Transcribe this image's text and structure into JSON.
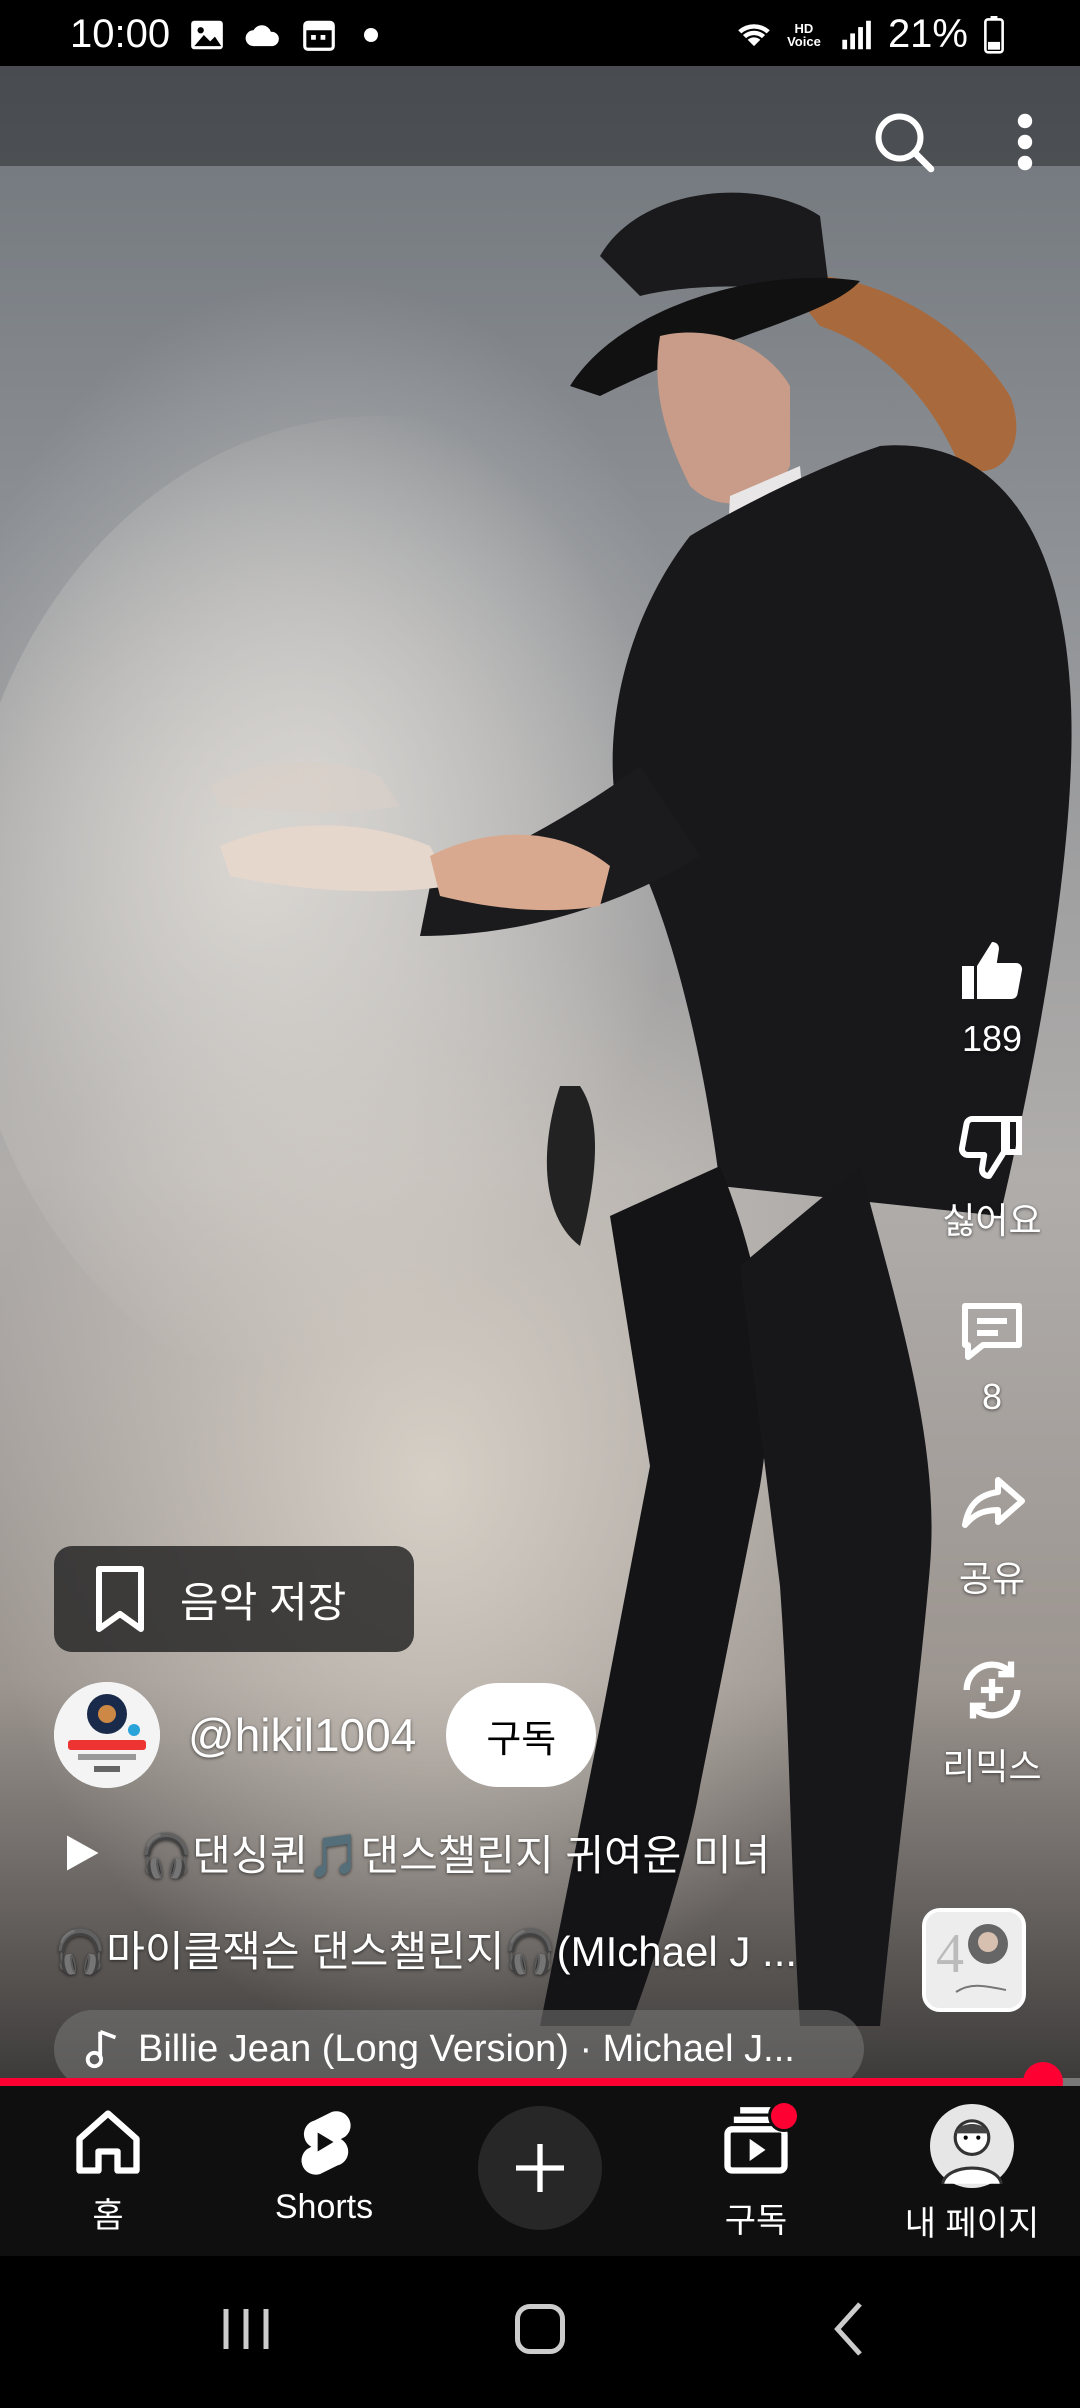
{
  "status_bar": {
    "time": "10:00",
    "battery": "21%",
    "hd_voice": "HD\nVoice"
  },
  "video": {
    "likes": "189",
    "dislike_label": "싫어요",
    "comments": "8",
    "share_label": "공유",
    "remix_label": "리믹스",
    "save_music_label": "음악 저장",
    "channel_handle": "@hikil1004",
    "subscribe_label": "구독",
    "title": "🎧댄싱퀸🎵댄스챌린지 귀여운 미녀",
    "description": "🎧마이클잭슨 댄스챌린지🎧(MIchael J ...",
    "music_label": "Billie Jean (Long Version) · Michael J...",
    "progress": 0.966
  },
  "bottom_nav": {
    "home": "홈",
    "shorts": "Shorts",
    "subscriptions": "구독",
    "you": "내 페이지"
  },
  "colors": {
    "accent": "#ff0033",
    "nav_bg": "#0f0f0f"
  }
}
